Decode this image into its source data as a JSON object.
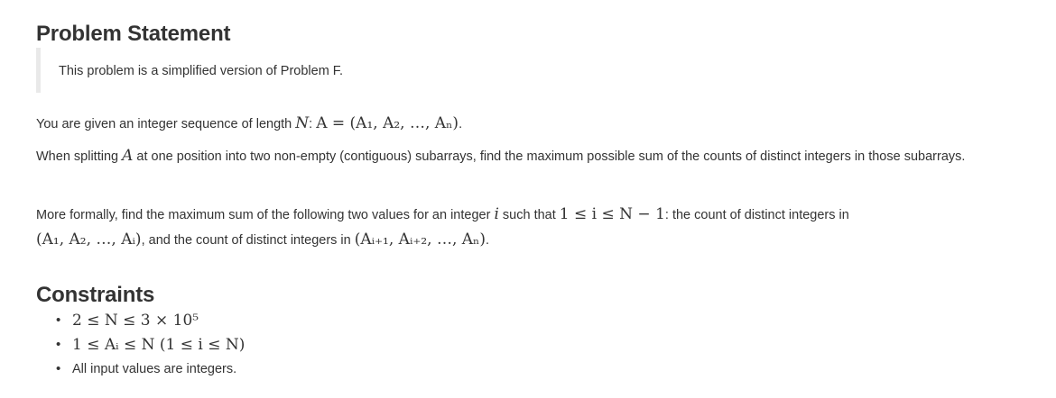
{
  "headings": {
    "problem": "Problem Statement",
    "constraints": "Constraints"
  },
  "note": "This problem is a simplified version of Problem F.",
  "para1": {
    "lead": "You are given an integer sequence of length ",
    "math_n": "N",
    "colon": ": ",
    "math_seq": "A = (A₁, A₂, …, Aₙ)",
    "end": "."
  },
  "para2": {
    "lead": "When splitting ",
    "math_a": "A",
    "rest": " at one position into two non-empty (contiguous) subarrays, find the maximum possible sum of the counts of distinct integers in those subarrays."
  },
  "para3": {
    "lead": "More formally, find the maximum sum of the following two values for an integer ",
    "math_i": "i",
    "mid": " such that ",
    "math_range": "1 ≤ i ≤ N − 1",
    "colon_text": ": the count of distinct integers in ",
    "math_left": "(A₁, A₂, …, Aᵢ)",
    "and_text": ", and the count of distinct integers in ",
    "math_right": "(Aᵢ₊₁, Aᵢ₊₂, …, Aₙ)",
    "end": "."
  },
  "constraints": {
    "c1": "2 ≤ N ≤ 3 × 10⁵",
    "c2": "1 ≤ Aᵢ ≤ N (1 ≤ i ≤ N)",
    "c3": "All input values are integers."
  }
}
